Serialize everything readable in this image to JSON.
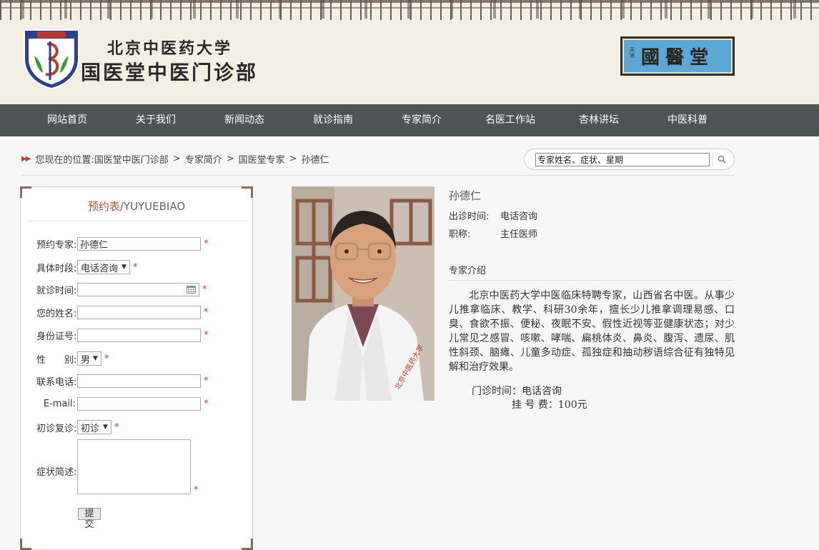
{
  "header": {
    "title_top": "北京中医药大学",
    "title_main": "国医堂中医门诊部",
    "plaque_text": "國醫堂",
    "plaque_small": "天池"
  },
  "nav": [
    "网站首页",
    "关于我们",
    "新闻动态",
    "就诊指南",
    "专家简介",
    "名医工作站",
    "杏林讲坛",
    "中医科普"
  ],
  "breadcrumb": {
    "prefix": "您现在的位置:",
    "items": [
      "国医堂中医门诊部",
      "专家简介",
      "国医堂专家",
      "孙德仁"
    ],
    "separator": ">"
  },
  "search": {
    "placeholder": "专家姓名、症状、星期"
  },
  "form": {
    "title_cn": "预约表",
    "title_en": "/YUYUEBIAO",
    "fields": {
      "expert_label": "预约专家:",
      "expert_value": "孙德仁",
      "period_label": "具体时段:",
      "period_value": "电话咨询",
      "visit_time_label": "就诊时间:",
      "name_label": "您的姓名:",
      "id_label": "身份证号:",
      "gender_label": "性　　别:",
      "gender_value": "男",
      "phone_label": "联系电话:",
      "email_label": "E-mail:",
      "visit_type_label": "初诊复诊:",
      "visit_type_value": "初诊",
      "symptom_label": "症状简述:"
    },
    "required_mark": "*",
    "submit_label": "提 交"
  },
  "doctor": {
    "name": "孙德仁",
    "schedule_label": "出诊时间:",
    "schedule_value": "电话咨询",
    "title_label": "职称:",
    "title_value": "主任医师",
    "intro_heading": "专家介绍",
    "intro_text": "北京中医药大学中医临床特聘专家，山西省名中医。从事少儿推拿临床、教学、科研30余年，擅长少儿推拿调理易感、口臭、食欲不振、便秘、夜眠不安、假性近视等亚健康状态；对少儿常见之感冒、咳嗽、哮喘、扁桃体炎、鼻炎、腹泻、遗尿、肌性斜颈、脑瘫、儿童多动症、孤独症和抽动秽语综合征有独特见解和治疗效果。",
    "consult_time": "门诊时间：电话咨询",
    "fee": "挂 号 费：100元"
  },
  "colors": {
    "nav_bg": "#4e5355",
    "accent": "#b4553a",
    "required": "#d33333"
  }
}
